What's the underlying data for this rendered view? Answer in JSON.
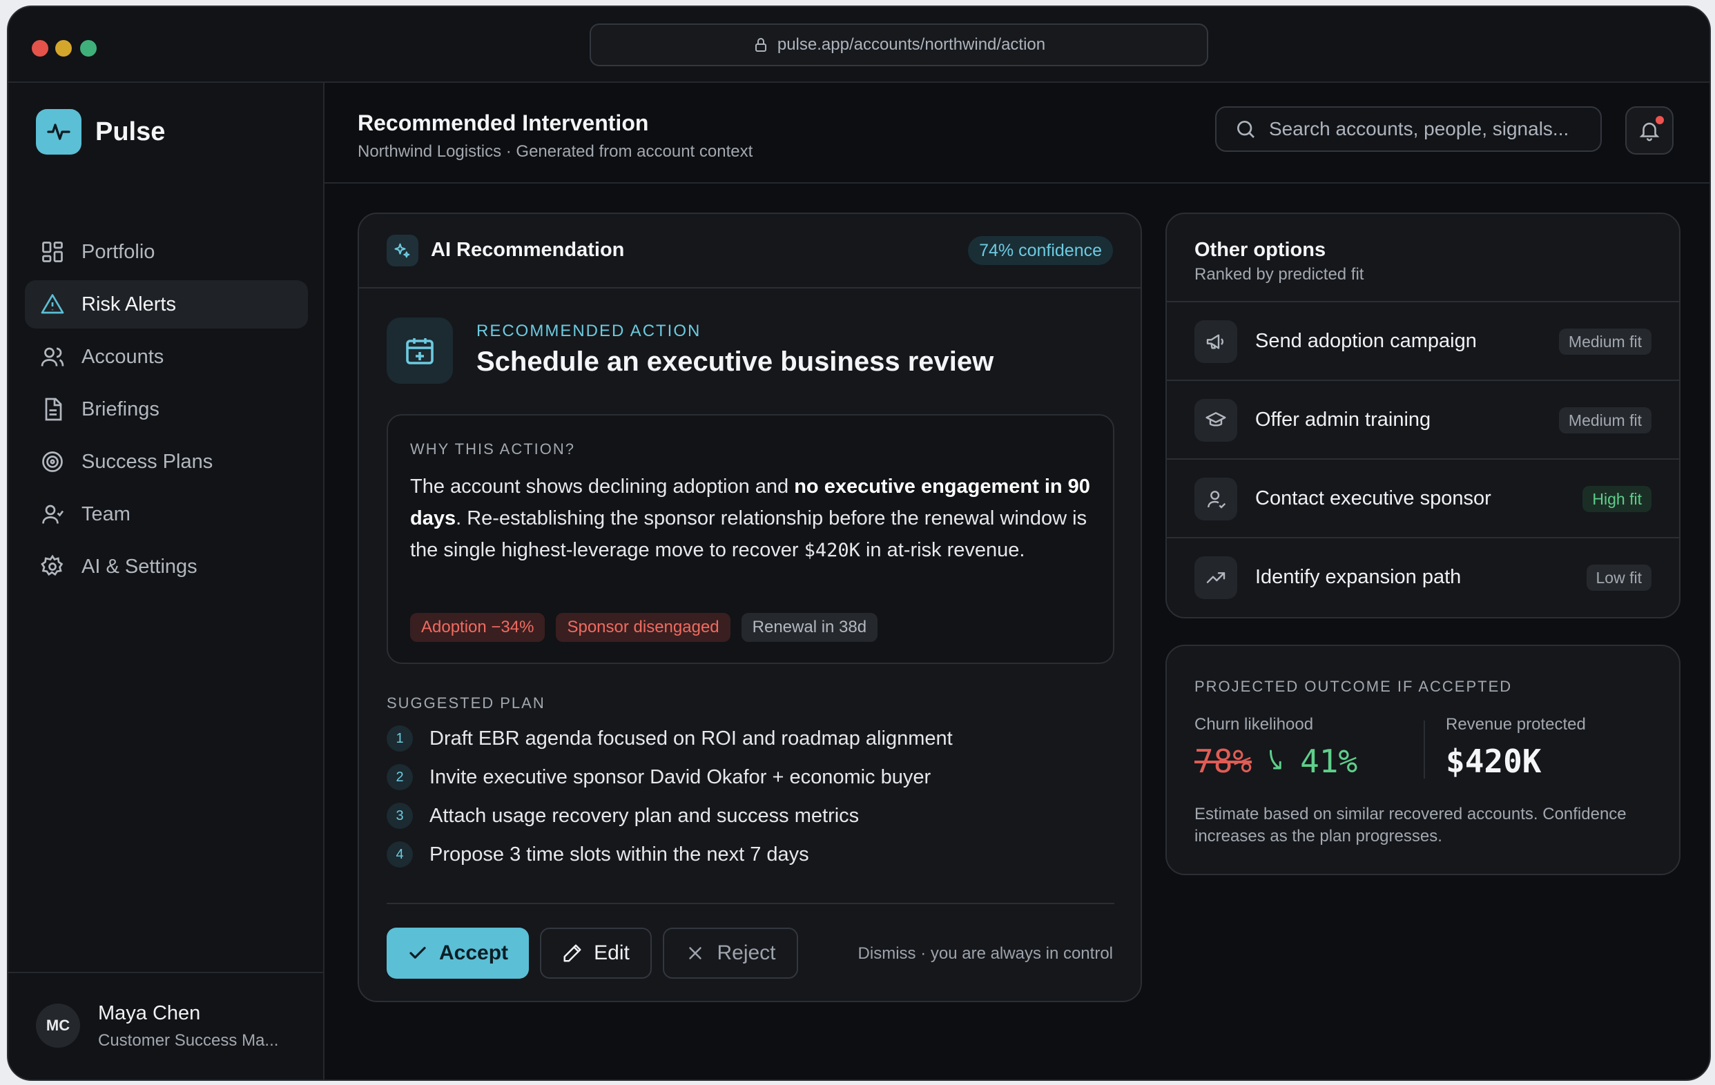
{
  "browser": {
    "url": "pulse.app/accounts/northwind/action"
  },
  "brand": {
    "name": "Pulse"
  },
  "sidebar": {
    "items": [
      {
        "label": "Portfolio",
        "icon": "grid-icon"
      },
      {
        "label": "Risk Alerts",
        "icon": "alert-triangle-icon",
        "active": true
      },
      {
        "label": "Accounts",
        "icon": "users-icon"
      },
      {
        "label": "Briefings",
        "icon": "document-icon"
      },
      {
        "label": "Success Plans",
        "icon": "target-icon"
      },
      {
        "label": "Team",
        "icon": "user-icon"
      },
      {
        "label": "AI & Settings",
        "icon": "gear-icon"
      }
    ]
  },
  "user": {
    "initials": "MC",
    "name": "Maya Chen",
    "role": "Customer Success Ma..."
  },
  "header": {
    "title": "Recommended Intervention",
    "subtitle": "Northwind Logistics · Generated from account context",
    "search_placeholder": "Search accounts, people, signals..."
  },
  "recommendation": {
    "card_title": "AI Recommendation",
    "confidence": "74% confidence",
    "label": "RECOMMENDED ACTION",
    "title": "Schedule an executive business review",
    "why_label": "WHY THIS ACTION?",
    "why_text_1": "The account shows declining adoption and ",
    "why_text_bold": "no executive engagement in 90 days",
    "why_text_2": ". Re-establishing the sponsor relationship before the renewal window is the single highest-leverage move to recover ",
    "why_amount": "$420K",
    "why_text_3": " in at-risk revenue.",
    "tags": [
      "Adoption −34%",
      "Sponsor disengaged",
      "Renewal in 38d"
    ],
    "plan_label": "SUGGESTED PLAN",
    "steps": [
      {
        "num": "1",
        "text": "Draft EBR agenda focused on ROI and roadmap alignment"
      },
      {
        "num": "2",
        "text": "Invite executive sponsor David Okafor + economic buyer"
      },
      {
        "num": "3",
        "text": "Attach usage recovery plan and success metrics"
      },
      {
        "num": "4",
        "text": "Propose 3 time slots within the next 7 days"
      }
    ],
    "accept_label": "Accept",
    "edit_label": "Edit",
    "reject_label": "Reject",
    "dismiss_text": "Dismiss · you are always in control"
  },
  "other_options": {
    "title": "Other options",
    "subtitle": "Ranked by predicted fit",
    "items": [
      {
        "label": "Send adoption campaign",
        "fit": "Medium fit",
        "icon": "megaphone-icon"
      },
      {
        "label": "Offer admin training",
        "fit": "Medium fit",
        "icon": "graduation-cap-icon"
      },
      {
        "label": "Contact executive sponsor",
        "fit": "High fit",
        "icon": "person-icon"
      },
      {
        "label": "Identify expansion path",
        "fit": "Low fit",
        "icon": "trending-up-icon"
      }
    ]
  },
  "projected": {
    "label": "PROJECTED OUTCOME IF ACCEPTED",
    "churn_label": "Churn likelihood",
    "churn_before": "78%",
    "churn_after": "41%",
    "revenue_label": "Revenue protected",
    "revenue_value": "$420K",
    "note": "Estimate based on similar recovered accounts. Confidence increases as the plan progresses."
  },
  "colors": {
    "accent": "#5bbfd6",
    "danger": "#e05d55",
    "success": "#5fcf8a",
    "background": "#0d0e11"
  }
}
